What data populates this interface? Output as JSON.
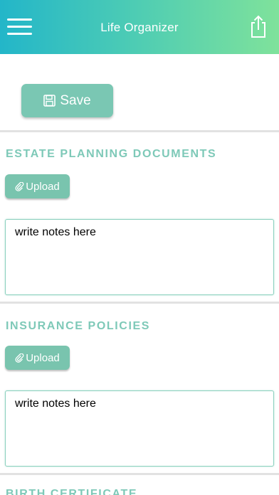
{
  "header": {
    "title": "Life Organizer",
    "menu_icon": "hamburger-menu-icon",
    "share_icon": "share-icon",
    "gradient_start": "#23b6c9",
    "gradient_end": "#7fe29b"
  },
  "toolbar": {
    "save_label": "Save",
    "save_icon": "floppy-disk-icon"
  },
  "sections": [
    {
      "title": "ESTATE PLANNING DOCUMENTS",
      "upload_label": "Upload",
      "upload_icon": "paperclip-icon",
      "notes_placeholder": "write notes here"
    },
    {
      "title": "INSURANCE POLICIES",
      "upload_label": "Upload",
      "upload_icon": "paperclip-icon",
      "notes_placeholder": "write notes here"
    },
    {
      "title": "BIRTH CERTIFICATE"
    }
  ],
  "colors": {
    "accent": "#7ac7b3",
    "section_title": "#7ec9b8",
    "divider": "#e2e2e2"
  }
}
